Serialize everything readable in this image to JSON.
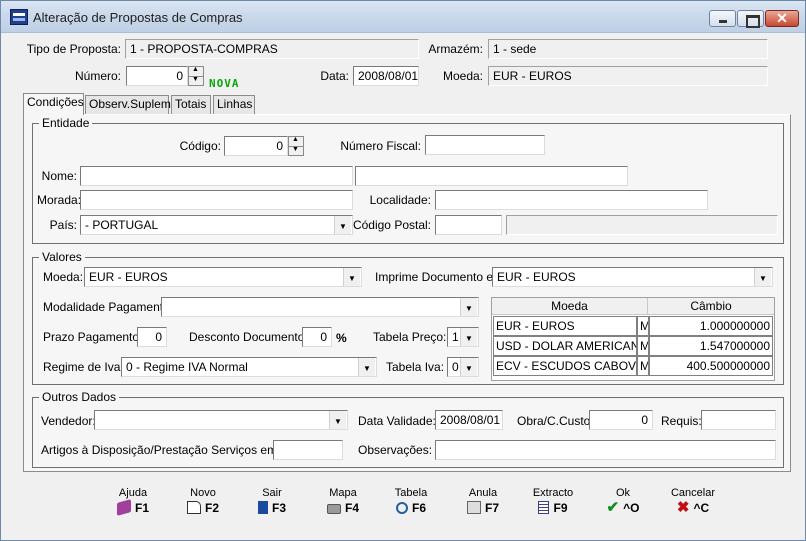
{
  "window": {
    "title": "Alteração de Propostas de Compras"
  },
  "header": {
    "tipo_label": "Tipo de Proposta:",
    "tipo_value": "1 - PROPOSTA-COMPRAS",
    "armazem_label": "Armazém:",
    "armazem_value": "1 - sede",
    "numero_label": "Número:",
    "numero_value": "0",
    "nova": "NOVA",
    "data_label": "Data:",
    "data_value": "2008/08/01",
    "moeda_label": "Moeda:",
    "moeda_value": "EUR - EUROS"
  },
  "tabs": [
    "Condições",
    "Observ.Suplem.",
    "Totais",
    "Linhas"
  ],
  "entidade": {
    "title": "Entidade",
    "codigo_label": "Código:",
    "codigo_value": "0",
    "nif_label": "Número Fiscal:",
    "nome_label": "Nome:",
    "morada_label": "Morada:",
    "localidade_label": "Localidade:",
    "pais_label": "País:",
    "pais_value": "- PORTUGAL",
    "cp_label": "Código Postal:"
  },
  "valores": {
    "title": "Valores",
    "moeda_label": "Moeda:",
    "moeda_value": "EUR - EUROS",
    "imprime_label": "Imprime Documento em:",
    "imprime_value": "EUR - EUROS",
    "modalidade_label": "Modalidade Pagamento:",
    "prazo_label": "Prazo Pagamento:",
    "prazo_value": "0",
    "desconto_label": "Desconto Documento:",
    "desconto_value": "0",
    "pct": "%",
    "tabela_preco_label": "Tabela Preço:",
    "tabela_preco_value": "1",
    "regime_label": "Regime de Iva:",
    "regime_value": "0 - Regime IVA Normal",
    "tabela_iva_label": "Tabela Iva:",
    "tabela_iva_value": "0",
    "grid_headers": [
      "Moeda",
      "Câmbio"
    ],
    "grid_rows": [
      {
        "moeda": "EUR - EUROS",
        "flag": "M",
        "cambio": "1.000000000"
      },
      {
        "moeda": "USD - DOLAR AMERICANO",
        "flag": "M",
        "cambio": "1.547000000"
      },
      {
        "moeda": "ECV - ESCUDOS CABOVERD",
        "flag": "M",
        "cambio": "400.500000000"
      }
    ]
  },
  "outros": {
    "title": "Outros Dados",
    "vendedor_label": "Vendedor:",
    "validade_label": "Data  Validade:",
    "validade_value": "2008/08/01",
    "obra_label": "Obra/C.Custo",
    "obra_value": "0",
    "requis_label": "Requis:",
    "artigos_label": "Artigos à Disposição/Prestação Serviços em:",
    "obs_label": "Observações:"
  },
  "buttons": [
    {
      "top": "Ajuda",
      "key": "F1",
      "icon": "book-icon",
      "color": "#a0409c"
    },
    {
      "top": "Novo",
      "key": "F2",
      "icon": "new-document-icon",
      "color": "#c08000"
    },
    {
      "top": "Sair",
      "key": "F3",
      "icon": "exit-door-icon",
      "color": "#1a4aa0"
    },
    {
      "top": "Mapa",
      "key": "F4",
      "icon": "printer-icon",
      "color": "#606060"
    },
    {
      "top": "Tabela",
      "key": "F6",
      "icon": "magnifier-table-icon",
      "color": "#2060a0"
    },
    {
      "top": "Anula",
      "key": "F7",
      "icon": "cancel-document-icon",
      "color": "#808080"
    },
    {
      "top": "Extracto",
      "key": "F9",
      "icon": "list-document-icon",
      "color": "#404080"
    },
    {
      "top": "Ok",
      "key": "^O",
      "icon": "checkmark-icon",
      "color": "#109020"
    },
    {
      "top": "Cancelar",
      "key": "^C",
      "icon": "red-x-icon",
      "color": "#c01010"
    }
  ]
}
